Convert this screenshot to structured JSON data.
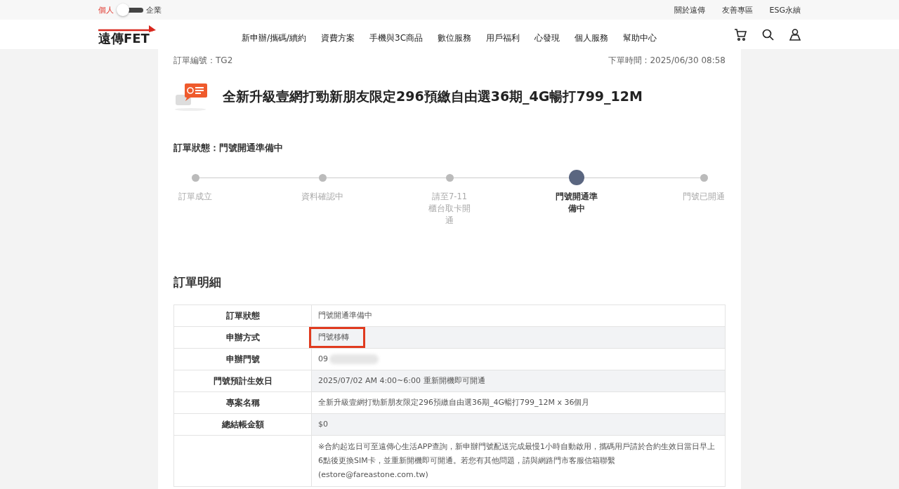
{
  "top_bar": {
    "segments": [
      {
        "label": "個人",
        "selected": true
      },
      {
        "label": "企業",
        "selected": false
      }
    ],
    "links": [
      "關於遠傳",
      "友善專區",
      "ESG永續"
    ]
  },
  "header": {
    "logo": "遠傳FET",
    "nav": [
      "新申辦/攜碼/續約",
      "資費方案",
      "手機與3C商品",
      "數位服務",
      "用戶福利",
      "心發現",
      "個人服務",
      "幫助中心"
    ]
  },
  "order": {
    "number": "訂單編號：TG2",
    "time": "下單時間 : 2025/06/30 08:58",
    "title": "全新升級壹網打勁新朋友限定296預繳自由選36期_4G暢打799_12M",
    "status": "訂單狀態：門號開通準備中",
    "steps": [
      {
        "label": "訂單成立",
        "current": false
      },
      {
        "label": "資料確認中",
        "current": false
      },
      {
        "label": "請至7-11櫃台取卡開通",
        "current": false
      },
      {
        "label": "門號開通準備中",
        "current": true
      },
      {
        "label": "門號已開通",
        "current": false
      }
    ]
  },
  "details": {
    "heading": "訂單明細",
    "rows": [
      {
        "label": "訂單狀態",
        "value": "門號開通準備中",
        "highlighted": false,
        "redacted": false
      },
      {
        "label": "申辦方式",
        "value": "門號移轉",
        "highlighted": true,
        "redacted": false
      },
      {
        "label": "申辦門號",
        "value": "09",
        "highlighted": false,
        "redacted": true
      },
      {
        "label": "門號預計生效日",
        "value": "2025/07/02 AM 4:00~6:00 重新開機即可開通",
        "highlighted": false,
        "redacted": false
      },
      {
        "label": "專案名稱",
        "value": "全新升級壹網打勁新朋友限定296預繳自由選36期_4G暢打799_12M x 36個月",
        "highlighted": false,
        "redacted": false
      },
      {
        "label": "總結帳金額",
        "value": "$0",
        "highlighted": false,
        "redacted": false
      },
      {
        "value": "※合約起迄日可至遠傳心生活APP查詢，新申辦門號配送完成最慢1小時自動啟用，攜碼用戶請於合約生效日當日早上6點後更換SIM卡，並重新開機即可開通。若您有其他問題，請與網路門市客服信箱聯繫(estore@fareastone.com.tw)",
        "highlighted": false,
        "redacted": false
      }
    ]
  }
}
